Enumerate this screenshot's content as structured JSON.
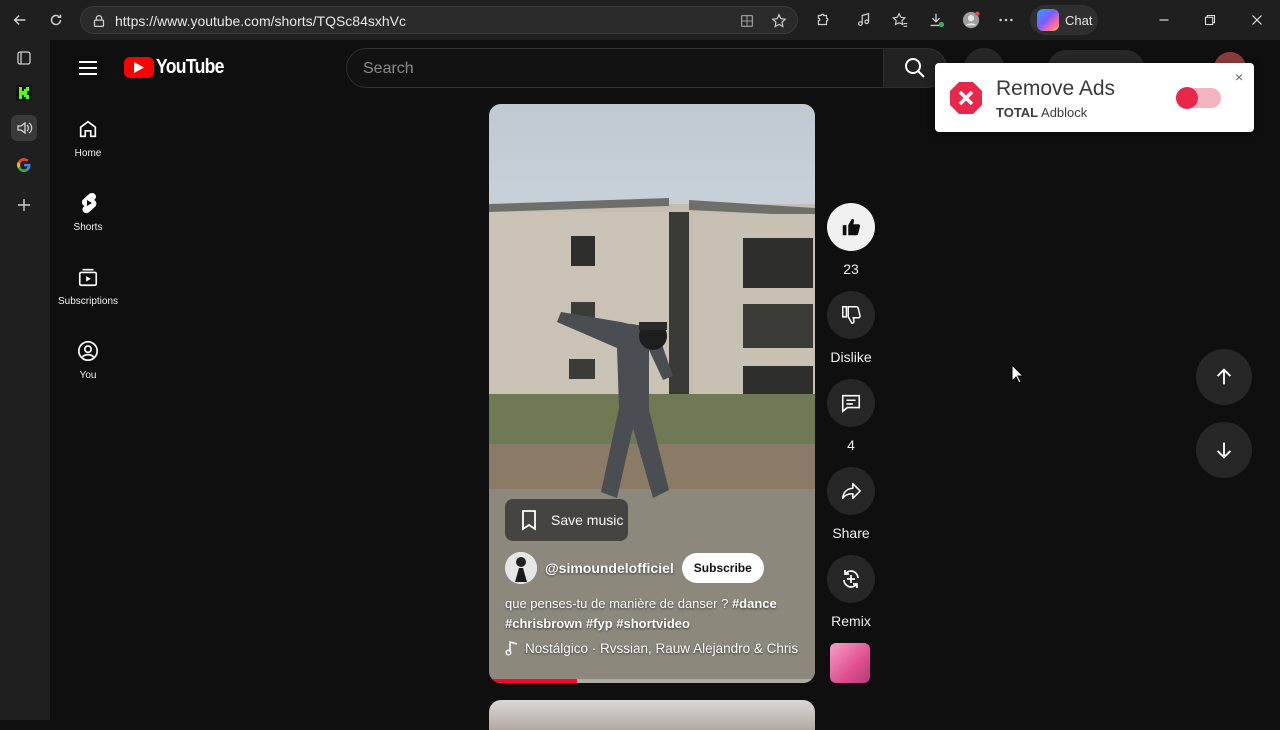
{
  "browser": {
    "url": "https://www.youtube.com/shorts/TQSc84sxhVc",
    "chat_label": "Chat"
  },
  "youtube": {
    "logo_text": "YouTube",
    "search_placeholder": "Search",
    "guide": [
      {
        "label": "Home",
        "icon": "home-icon"
      },
      {
        "label": "Shorts",
        "icon": "shorts-icon"
      },
      {
        "label": "Subscriptions",
        "icon": "subscriptions-icon"
      },
      {
        "label": "You",
        "icon": "you-icon"
      }
    ]
  },
  "short": {
    "save_music_label": "Save music",
    "channel": "@simoundelofficiel",
    "subscribe_label": "Subscribe",
    "description_text": "que penses-tu de manière de danser ?",
    "hashtags_line1": "#dance",
    "hashtags_line2": "#chrisbrown #fyp #shortvideo",
    "music": "Nostálgico · Rvssian, Rauw Alejandro & Chris",
    "progress": 0.27
  },
  "actions": {
    "like_count": "23",
    "dislike_label": "Dislike",
    "comment_count": "4",
    "share_label": "Share",
    "remix_label": "Remix"
  },
  "adblock": {
    "title": "Remove Ads",
    "brand_bold": "TOTAL",
    "brand_rest": " Adblock",
    "close": "×",
    "toggle_on": true
  },
  "colors": {
    "accent": "#ff0000",
    "progress": "#ff0033",
    "toggle": "#e8284a"
  }
}
